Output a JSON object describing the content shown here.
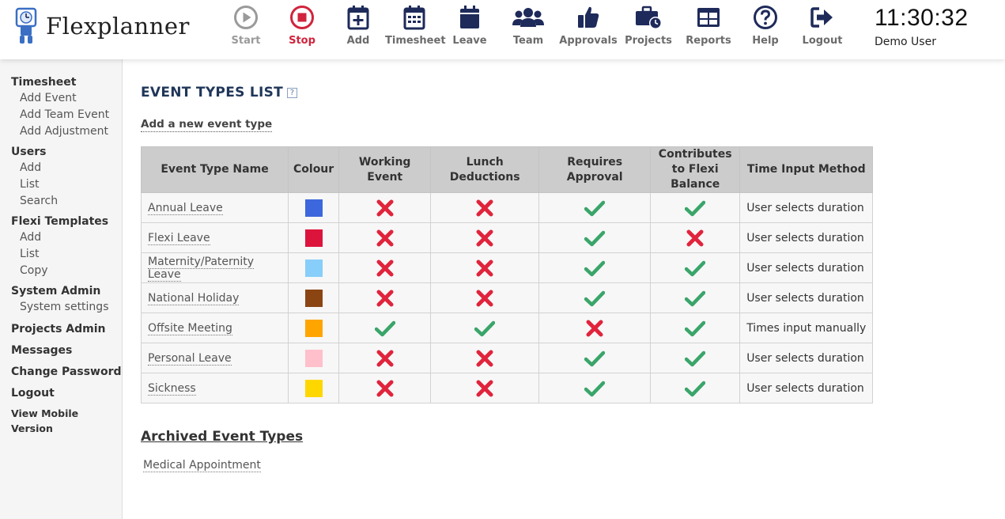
{
  "app": {
    "name": "Flexplanner"
  },
  "nav": [
    {
      "label": "Start",
      "icon": "play-circle-icon"
    },
    {
      "label": "Stop",
      "icon": "stop-circle-icon"
    },
    {
      "label": "Add",
      "icon": "calendar-plus-icon"
    },
    {
      "label": "Timesheet",
      "icon": "calendar-grid-icon"
    },
    {
      "label": "Leave",
      "icon": "calendar-icon"
    },
    {
      "label": "Team",
      "icon": "users-icon"
    },
    {
      "label": "Approvals",
      "icon": "thumbs-up-icon"
    },
    {
      "label": "Projects",
      "icon": "briefcase-clock-icon"
    },
    {
      "label": "Reports",
      "icon": "table-icon"
    },
    {
      "label": "Help",
      "icon": "question-circle-icon"
    },
    {
      "label": "Logout",
      "icon": "sign-out-icon"
    }
  ],
  "clock": "11:30:32",
  "user": "Demo User",
  "sidebar": {
    "timesheet": {
      "label": "Timesheet",
      "items": [
        "Add Event",
        "Add Team Event",
        "Add Adjustment"
      ]
    },
    "users": {
      "label": "Users",
      "items": [
        "Add",
        "List",
        "Search"
      ]
    },
    "flexi": {
      "label": "Flexi Templates",
      "items": [
        "Add",
        "List",
        "Copy"
      ]
    },
    "sysadmin": {
      "label": "System Admin",
      "items": [
        "System settings"
      ]
    },
    "projects_admin": "Projects Admin",
    "messages": "Messages",
    "change_password": "Change Password",
    "logout": "Logout",
    "mobile": "View Mobile Version"
  },
  "main": {
    "title": "EVENT TYPES LIST",
    "help": "?",
    "add_link": "Add a new event type",
    "columns": [
      "Event Type Name",
      "Colour",
      "Working Event",
      "Lunch Deductions",
      "Requires Approval",
      "Contributes to Flexi Balance",
      "Time Input Method"
    ],
    "rows": [
      {
        "name": "Annual Leave",
        "colour": "#3d67dc",
        "working": false,
        "lunch": false,
        "approval": true,
        "flexi": true,
        "method": "User selects duration"
      },
      {
        "name": "Flexi Leave",
        "colour": "#dc143c",
        "working": false,
        "lunch": false,
        "approval": true,
        "flexi": false,
        "method": "User selects duration"
      },
      {
        "name": "Maternity/Paternity Leave",
        "colour": "#87cefa",
        "working": false,
        "lunch": false,
        "approval": true,
        "flexi": true,
        "method": "User selects duration"
      },
      {
        "name": "National Holiday",
        "colour": "#8b4513",
        "working": false,
        "lunch": false,
        "approval": true,
        "flexi": true,
        "method": "User selects duration"
      },
      {
        "name": "Offsite Meeting",
        "colour": "#ffa500",
        "working": true,
        "lunch": true,
        "approval": false,
        "flexi": true,
        "method": "Times input manually"
      },
      {
        "name": "Personal Leave",
        "colour": "#ffc0cb",
        "working": false,
        "lunch": false,
        "approval": true,
        "flexi": true,
        "method": "User selects duration"
      },
      {
        "name": "Sickness",
        "colour": "#ffd700",
        "working": false,
        "lunch": false,
        "approval": true,
        "flexi": true,
        "method": "User selects duration"
      }
    ],
    "archived_title": "Archived Event Types",
    "archived": [
      "Medical Appointment"
    ]
  },
  "colors": {
    "check": "#3aa56a",
    "cross": "#e0243c",
    "title": "#1f3658",
    "nav_icon": "#1e2a5a"
  }
}
